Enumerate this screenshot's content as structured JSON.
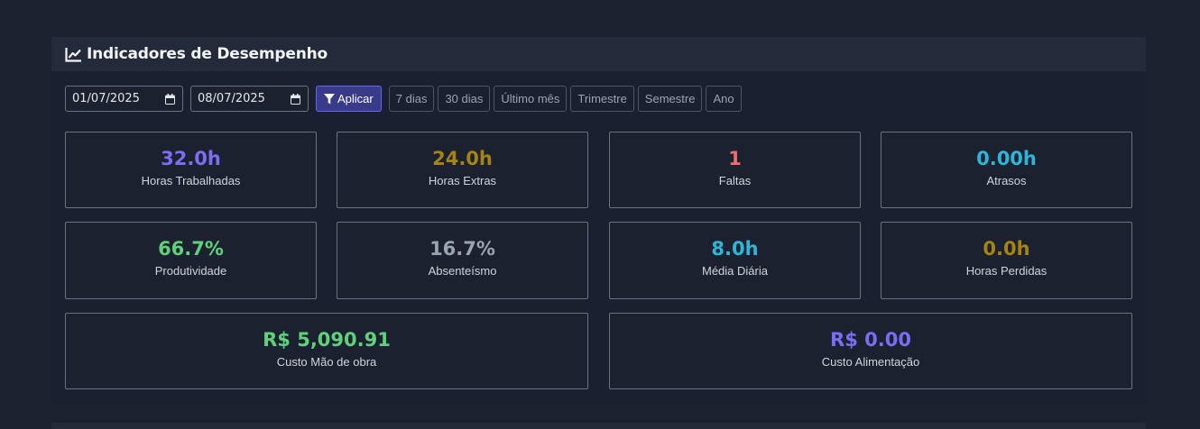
{
  "header": {
    "title": "Indicadores de Desempenho",
    "icon": "chart-line-icon"
  },
  "filters": {
    "start_date": "01/07/2025",
    "end_date": "08/07/2025",
    "apply_label": "Aplicar",
    "ranges": [
      "7 dias",
      "30 dias",
      "Último mês",
      "Trimestre",
      "Semestre",
      "Ano"
    ]
  },
  "stats": [
    {
      "value": "32.0h",
      "label": "Horas Trabalhadas",
      "color": "#7c6cf6"
    },
    {
      "value": "24.0h",
      "label": "Horas Extras",
      "color": "#a68412"
    },
    {
      "value": "1",
      "label": "Faltas",
      "color": "#f26b6b"
    },
    {
      "value": "0.00h",
      "label": "Atrasos",
      "color": "#2eb6d8"
    },
    {
      "value": "66.7%",
      "label": "Produtividade",
      "color": "#5fd17a"
    },
    {
      "value": "16.7%",
      "label": "Absenteísmo",
      "color": "#9aa3b2"
    },
    {
      "value": "8.0h",
      "label": "Média Diária",
      "color": "#2eb6d8"
    },
    {
      "value": "0.0h",
      "label": "Horas Perdidas",
      "color": "#a68412"
    },
    {
      "value": "R$ 5,090.91",
      "label": "Custo Mão de obra",
      "color": "#5fd17a"
    },
    {
      "value": "R$ 0.00",
      "label": "Custo Alimentação",
      "color": "#7c6cf6"
    }
  ]
}
